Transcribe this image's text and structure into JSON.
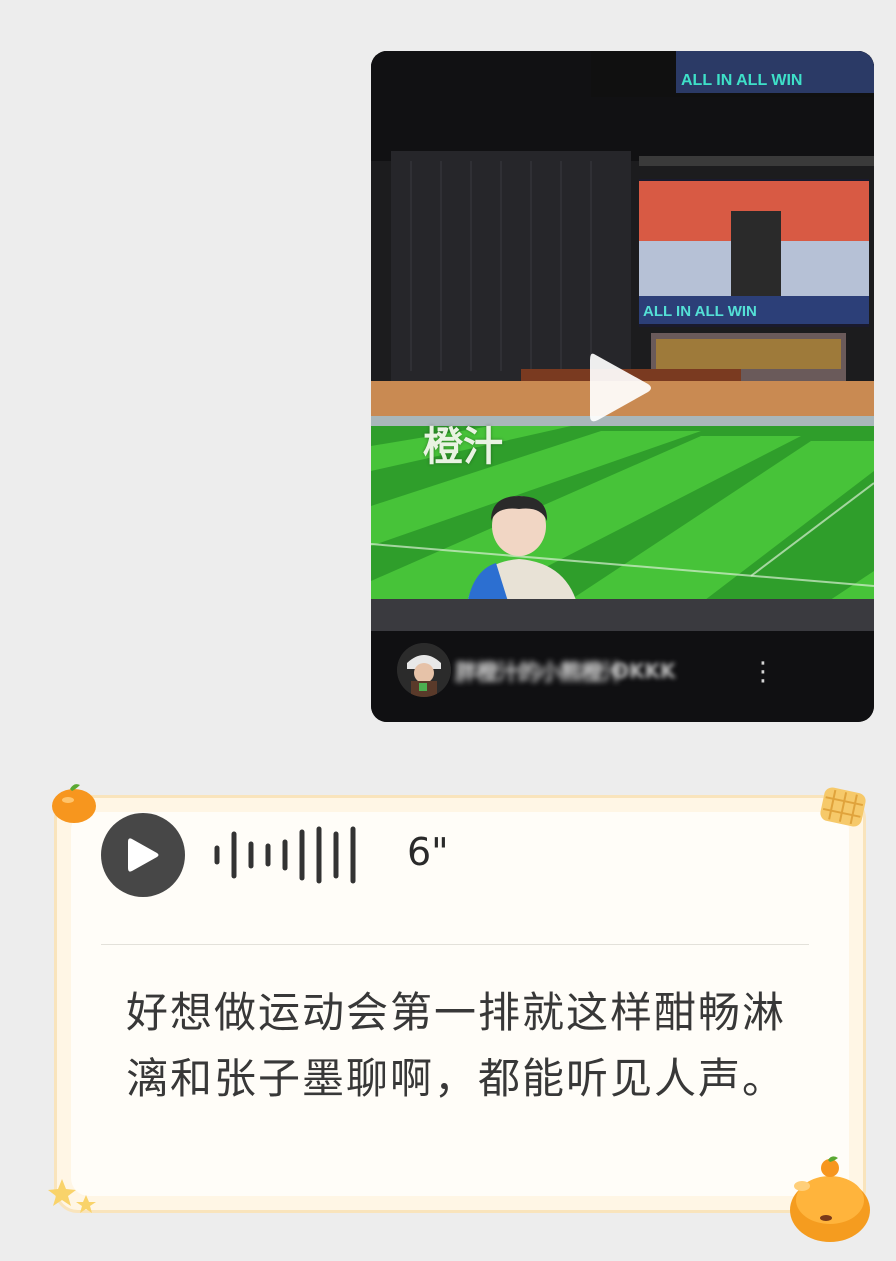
{
  "video_message": {
    "watermark": "橙汁",
    "led_banner": "ALL IN ALL WIN",
    "author_name": "胖橙汁的小熊橙汁",
    "author_name_2": "OKKK",
    "more_label": "⋮",
    "play_icon": "play-triangle-icon"
  },
  "voice_message": {
    "duration": "6\"",
    "transcript": "好想做运动会第一排就这样酣畅淋漓和张子墨聊啊，都能听见人声。",
    "play_icon": "play-icon",
    "accent_color": "#f9e4bc",
    "background_color": "#fffdf8"
  },
  "colors": {
    "page_background": "#ededed",
    "field_green_light": "#47c339",
    "field_green_dark": "#2f9e2b",
    "play_button": "#474747"
  }
}
